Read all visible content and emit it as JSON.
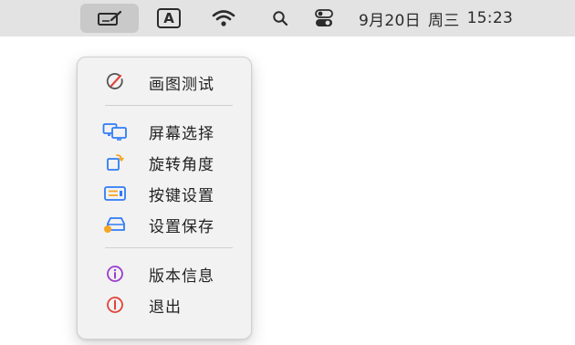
{
  "menubar": {
    "input_source_label": "A",
    "clock": {
      "date": "9月20日",
      "weekday": "周三",
      "time": "15:23"
    }
  },
  "menu": {
    "items": [
      {
        "label": "画图测试",
        "icon": "brush-gauge-icon"
      },
      {
        "label": "屏幕选择",
        "icon": "displays-icon"
      },
      {
        "label": "旋转角度",
        "icon": "rotate-icon"
      },
      {
        "label": "按键设置",
        "icon": "keyboard-icon"
      },
      {
        "label": "设置保存",
        "icon": "save-drive-icon"
      },
      {
        "label": "版本信息",
        "icon": "info-icon"
      },
      {
        "label": "退出",
        "icon": "quit-icon"
      }
    ]
  },
  "colors": {
    "menubar_bg": "#e3e3e3",
    "menu_bg": "#f2f2f2",
    "accent_blue": "#2f7cf6",
    "accent_orange": "#f5a623",
    "accent_purple": "#9b3dd0",
    "accent_red": "#e0443a"
  }
}
